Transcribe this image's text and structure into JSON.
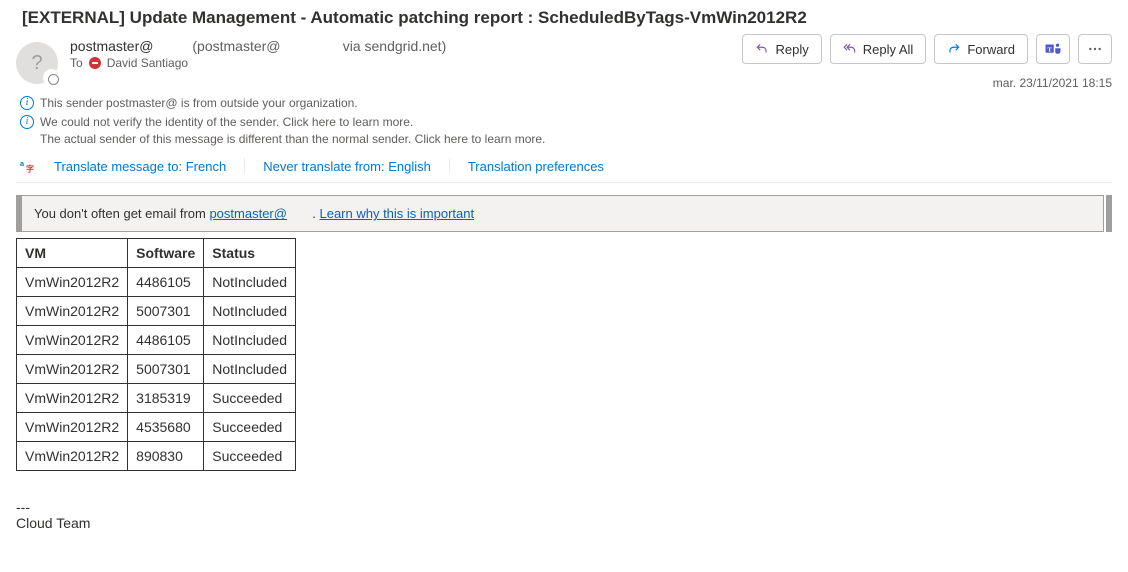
{
  "subject": "[EXTERNAL] Update Management - Automatic patching report : ScheduledByTags-VmWin2012R2",
  "avatar_initial": "?",
  "sender": {
    "display": "postmaster@",
    "parenthetical_prefix": "(postmaster@",
    "via_suffix": "via sendgrid.net)"
  },
  "to": {
    "label": "To",
    "recipient": "David Santiago"
  },
  "actions": {
    "reply": "Reply",
    "reply_all": "Reply All",
    "forward": "Forward"
  },
  "timestamp": "mar. 23/11/2021 18:15",
  "warning1": "This sender postmaster@            is from outside your organization.",
  "warning2": "We could not verify the identity of the sender. Click here to learn more.",
  "warning2b": "The actual sender of this message is different than the normal sender. Click here to learn more.",
  "translate": {
    "to": "Translate message to: French",
    "never": "Never translate from: English",
    "prefs": "Translation preferences"
  },
  "tip": {
    "prefix": "You don't often get email from ",
    "email": "postmaster@",
    "suffix_sep": ". ",
    "learn": "Learn why this is important"
  },
  "table": {
    "headers": [
      "VM",
      "Software",
      "Status"
    ],
    "rows": [
      [
        "VmWin2012R2",
        "4486105",
        "NotIncluded"
      ],
      [
        "VmWin2012R2",
        "5007301",
        "NotIncluded"
      ],
      [
        "VmWin2012R2",
        "4486105",
        "NotIncluded"
      ],
      [
        "VmWin2012R2",
        "5007301",
        "NotIncluded"
      ],
      [
        "VmWin2012R2",
        "3185319",
        "Succeeded"
      ],
      [
        "VmWin2012R2",
        "4535680",
        "Succeeded"
      ],
      [
        "VmWin2012R2",
        "890830",
        "Succeeded"
      ]
    ]
  },
  "signature": {
    "sep": "---",
    "line": "Cloud Team"
  }
}
